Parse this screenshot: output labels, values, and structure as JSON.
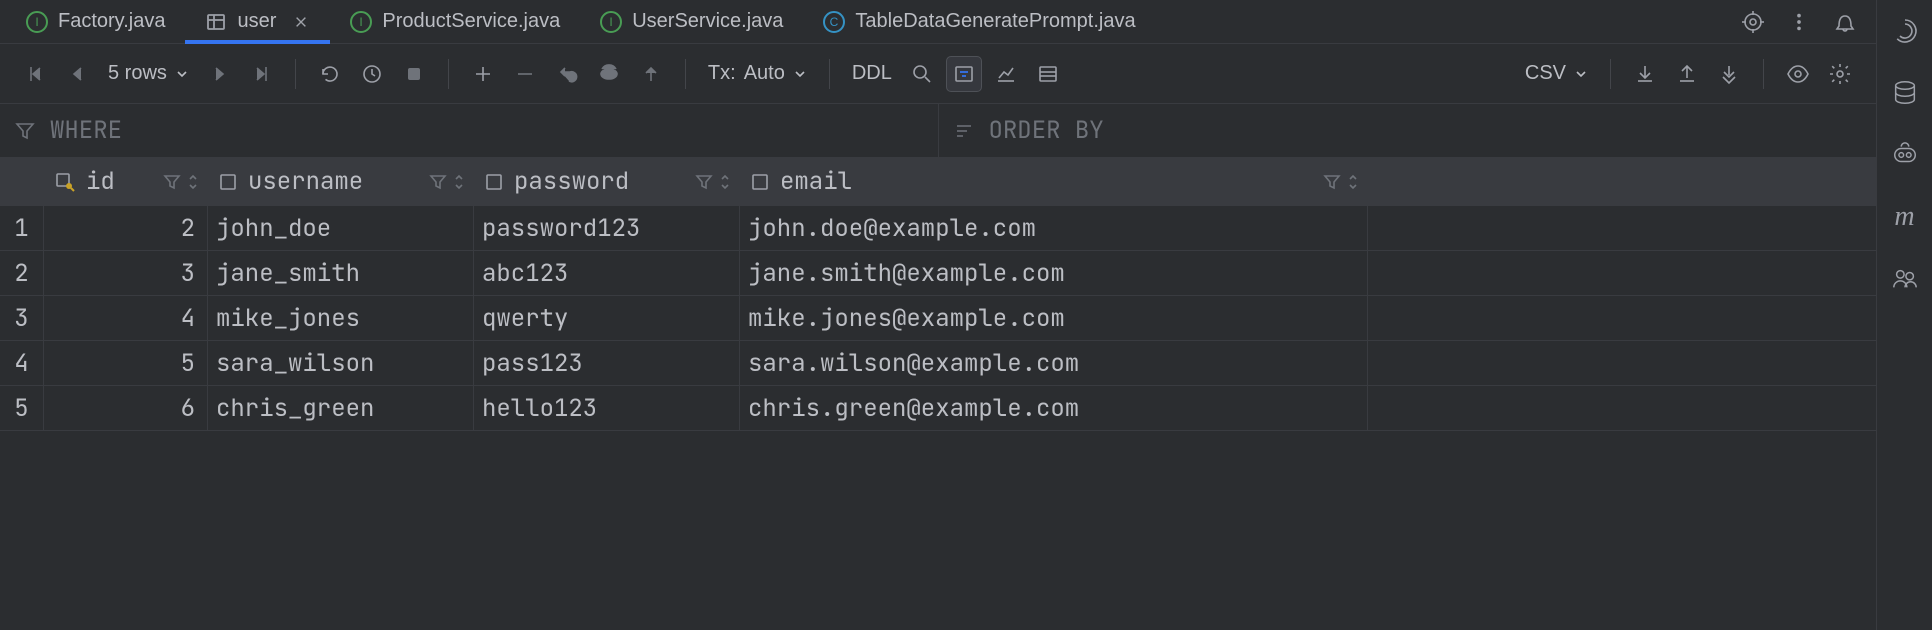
{
  "tabs": [
    {
      "label": "Factory.java",
      "icon": "java-class-icon",
      "active": false
    },
    {
      "label": "user",
      "icon": "table-icon",
      "active": true,
      "closable": true
    },
    {
      "label": "ProductService.java",
      "icon": "java-class-icon",
      "active": false
    },
    {
      "label": "UserService.java",
      "icon": "java-interface-icon",
      "active": false
    },
    {
      "label": "TableDataGeneratePrompt.java",
      "icon": "java-class-blue-icon",
      "active": false
    }
  ],
  "toolbar": {
    "rows_label": "5 rows",
    "tx_label": "Tx:",
    "tx_mode": "Auto",
    "ddl_label": "DDL",
    "export_format": "CSV"
  },
  "filters": {
    "where_label": "WHERE",
    "orderby_label": "ORDER BY"
  },
  "columns": [
    {
      "name": "id",
      "key": true
    },
    {
      "name": "username"
    },
    {
      "name": "password"
    },
    {
      "name": "email"
    }
  ],
  "rows": [
    {
      "n": "1",
      "id": "2",
      "username": "john_doe",
      "password": "password123",
      "email": "john.doe@example.com"
    },
    {
      "n": "2",
      "id": "3",
      "username": "jane_smith",
      "password": "abc123",
      "email": "jane.smith@example.com"
    },
    {
      "n": "3",
      "id": "4",
      "username": "mike_jones",
      "password": "qwerty",
      "email": "mike.jones@example.com"
    },
    {
      "n": "4",
      "id": "5",
      "username": "sara_wilson",
      "password": "pass123",
      "email": "sara.wilson@example.com"
    },
    {
      "n": "5",
      "id": "6",
      "username": "chris_green",
      "password": "hello123",
      "email": "chris.green@example.com"
    }
  ]
}
